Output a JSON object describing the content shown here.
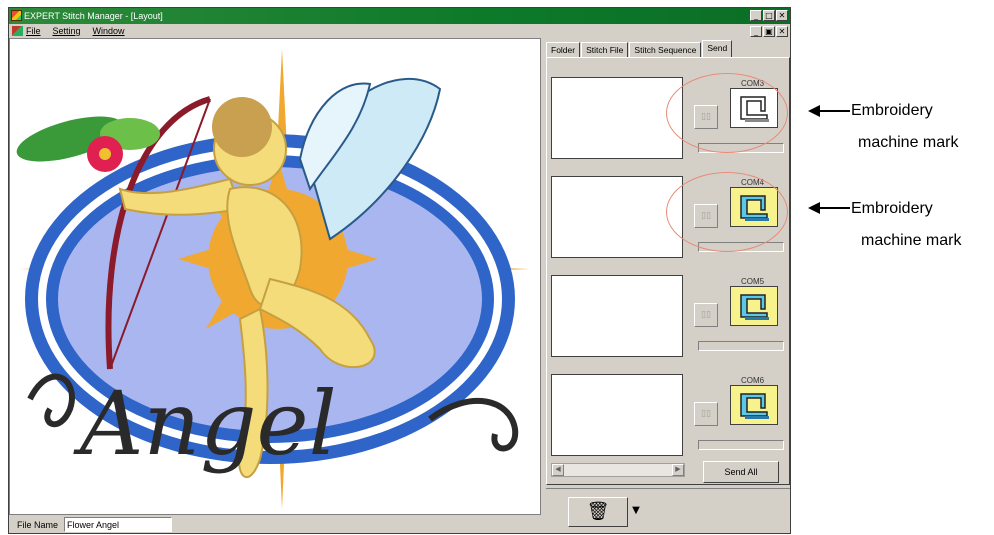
{
  "window": {
    "title": "EXPERT Stitch Manager - [Layout]",
    "controls": [
      "_",
      "□",
      "✕"
    ],
    "mdi_controls": [
      "_",
      "▣",
      "✕"
    ]
  },
  "menu": {
    "file": "File",
    "setting": "Setting",
    "window": "Window"
  },
  "canvas": {
    "design_text": "Angel"
  },
  "file_name": {
    "label": "File Name",
    "value": "Flower Angel"
  },
  "tabs": [
    "Folder",
    "Stitch File",
    "Stitch Sequence",
    "Send"
  ],
  "active_tab": "Send",
  "slots": [
    {
      "com": "COM3",
      "machine_state": "white"
    },
    {
      "com": "COM4",
      "machine_state": "yellow"
    },
    {
      "com": "COM5",
      "machine_state": "yellow"
    },
    {
      "com": "COM6",
      "machine_state": "yellow"
    }
  ],
  "send_all_label": "Send All",
  "icons": {
    "send": "send-signal-icon",
    "machine": "embroidery-machine-icon",
    "trash": "trash-icon",
    "dropdown": "dropdown-arrow-icon"
  },
  "annotations": [
    {
      "line1": "Embroidery",
      "line2": "machine mark"
    },
    {
      "line1": "Embroidery",
      "line2": "machine mark"
    }
  ],
  "colors": {
    "titlebar": "#0d7a2a",
    "machine_yellow": "#f8f28c",
    "machine_cyan": "#5ac8e6",
    "highlight_ellipse": "#e88a7a"
  }
}
